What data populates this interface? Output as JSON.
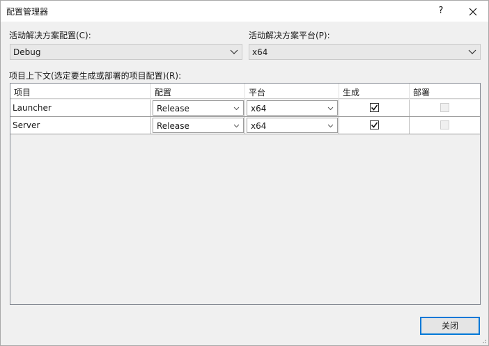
{
  "window": {
    "title": "配置管理器",
    "help_label": "?",
    "close_label": "✕"
  },
  "active_config": {
    "label": "活动解决方案配置(C):",
    "value": "Debug"
  },
  "active_platform": {
    "label": "活动解决方案平台(P):",
    "value": "x64"
  },
  "project_context": {
    "label": "项目上下文(选定要生成或部署的项目配置)(R):",
    "columns": [
      "项目",
      "配置",
      "平台",
      "生成",
      "部署"
    ],
    "rows": [
      {
        "project": "Launcher",
        "config": "Release",
        "platform": "x64",
        "build": true,
        "deploy": false
      },
      {
        "project": "Server",
        "config": "Release",
        "platform": "x64",
        "build": true,
        "deploy": false
      }
    ]
  },
  "footer": {
    "close_button": "关闭"
  },
  "colors": {
    "accent": "#0078d7",
    "window_bg": "#f0f0f0"
  }
}
